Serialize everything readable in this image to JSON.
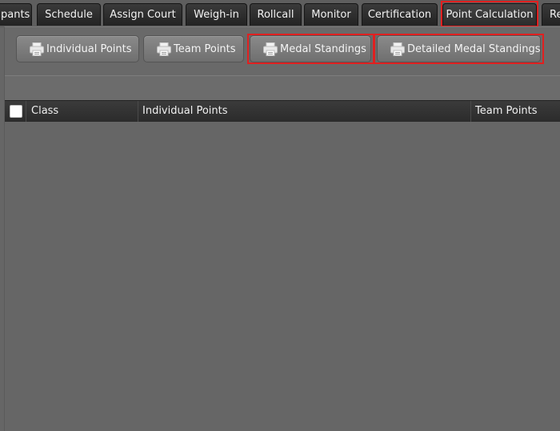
{
  "tabs": [
    {
      "label": "pants",
      "active": false
    },
    {
      "label": "Schedule",
      "active": false
    },
    {
      "label": "Assign Court",
      "active": false
    },
    {
      "label": "Weigh-in",
      "active": false
    },
    {
      "label": "Rollcall",
      "active": false
    },
    {
      "label": "Monitor",
      "active": false
    },
    {
      "label": "Certification",
      "active": false
    },
    {
      "label": "Point Calculation",
      "active": true
    },
    {
      "label": "Re",
      "active": false
    }
  ],
  "toolbar": {
    "individual_points": "Individual Points",
    "team_points": "Team Points",
    "medal_standings": "Medal Standings",
    "detailed_medal_standings": "Detailed Medal Standings",
    "button_icon": "printer-icon"
  },
  "grid": {
    "columns": [
      "Class",
      "Individual Points",
      "Team Points"
    ],
    "rows": []
  },
  "colors": {
    "highlight": "#e02020",
    "background": "#666666"
  }
}
